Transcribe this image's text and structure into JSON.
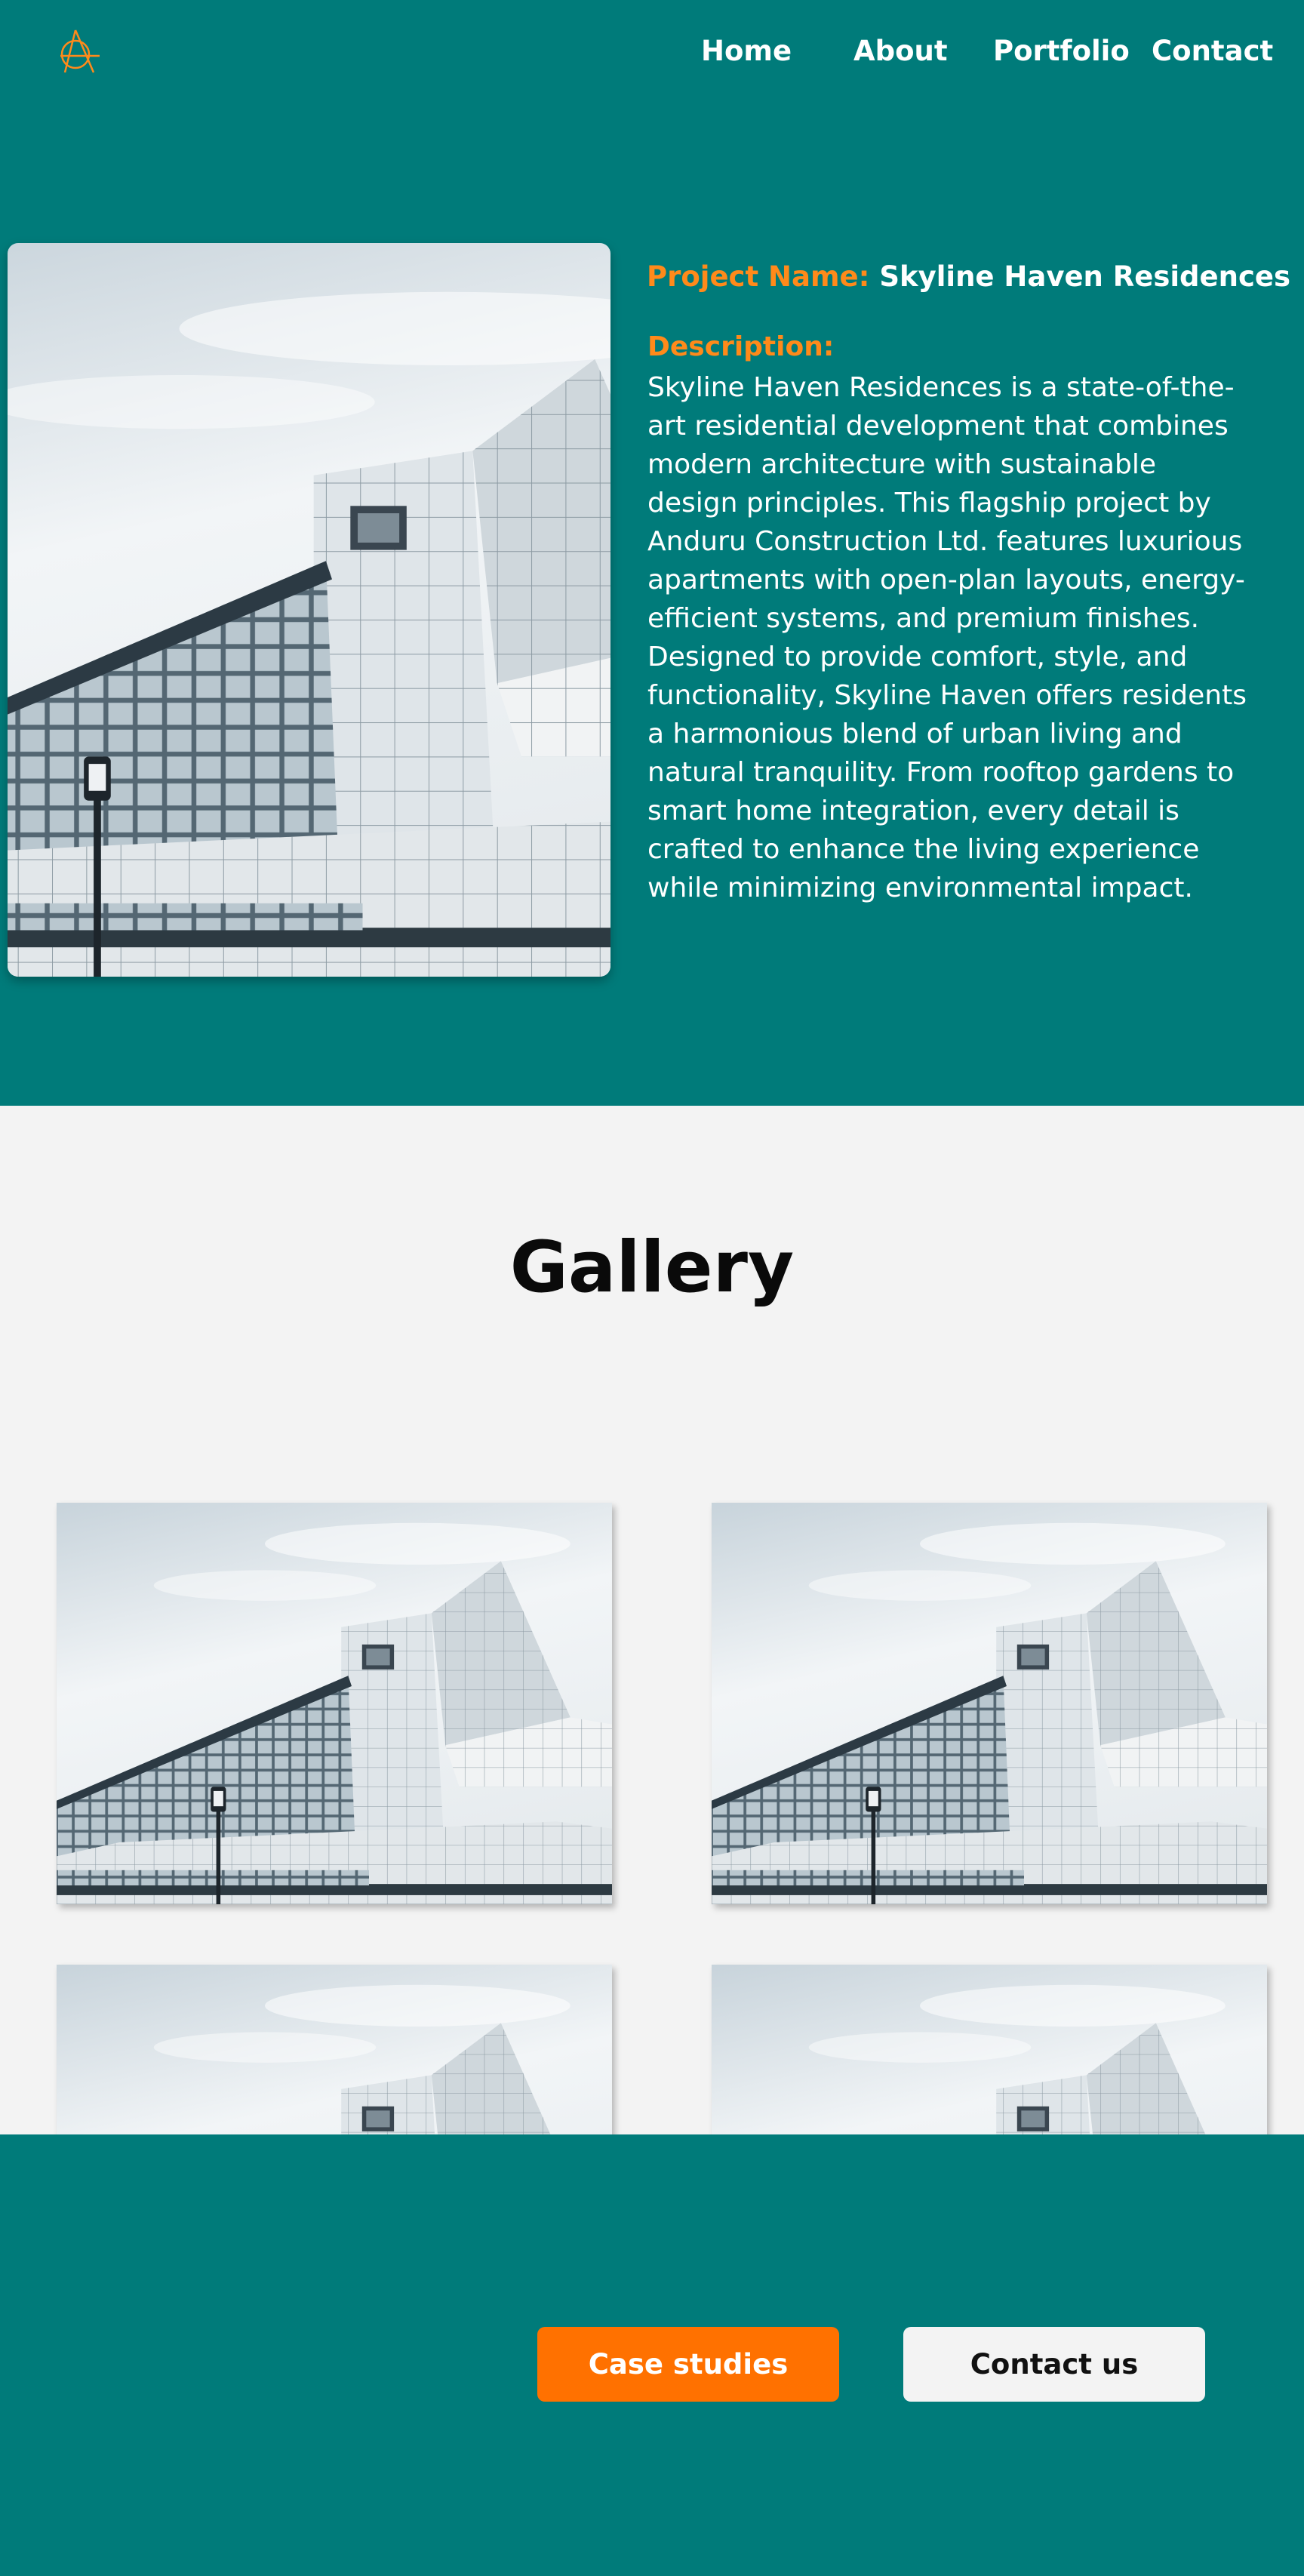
{
  "nav": {
    "home": "Home",
    "about": "About",
    "portfolio": "Portfolio",
    "contact": "Contact"
  },
  "project": {
    "name_label": "Project Name:",
    "name_value": "Skyline Haven Residences",
    "description_label": "Description:",
    "description": "Skyline Haven Residences is a state-of-the-art residential development that combines modern architecture with sustainable design principles. This flagship project by Anduru Construction Ltd. features luxurious apartments with open-plan layouts, energy-efficient systems, and premium finishes. Designed to provide comfort, style, and functionality, Skyline Haven offers residents a harmonious blend of urban living and natural tranquility. From rooftop gardens to smart home integration, every detail is crafted to enhance the living experience while minimizing environmental impact."
  },
  "gallery": {
    "title": "Gallery"
  },
  "footer": {
    "case_studies": "Case studies",
    "contact_us": "Contact us"
  },
  "colors": {
    "teal": "#007b7a",
    "orange": "#ff7100",
    "label_orange": "#ff8a1a",
    "light_bg": "#f3f3f3"
  },
  "icons": {
    "logo": "anduru-logo-icon"
  }
}
